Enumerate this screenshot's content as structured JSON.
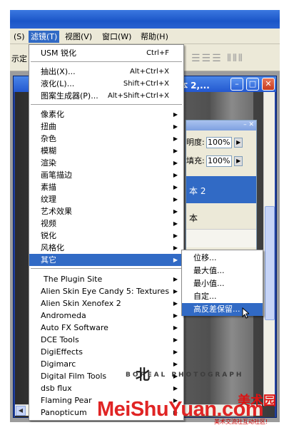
{
  "menubar": {
    "items": [
      "(S)",
      "滤镜(T)",
      "视图(V)",
      "窗口(W)",
      "帮助(H)"
    ]
  },
  "optbar": {
    "label": "示定",
    "align_icons": "☰☰☰ ⫴⫴⫴"
  },
  "document": {
    "title": "本 2,..."
  },
  "layers": {
    "opacity_label": "明度:",
    "opacity_value": "100%",
    "fill_label": "填充:",
    "fill_value": "100%",
    "selected_layer": "本 2",
    "other_layer": "本"
  },
  "filter_menu": {
    "top": [
      {
        "label": "USM 锐化",
        "shortcut": "Ctrl+F"
      }
    ],
    "group2": [
      {
        "label": "抽出(X)...",
        "shortcut": "Alt+Ctrl+X"
      },
      {
        "label": "液化(L)...",
        "shortcut": "Shift+Ctrl+X"
      },
      {
        "label": "图案生成器(P)...",
        "shortcut": "Alt+Shift+Ctrl+X"
      }
    ],
    "submenus": [
      "像素化",
      "扭曲",
      "杂色",
      "模糊",
      "渲染",
      "画笔描边",
      "素描",
      "纹理",
      "艺术效果",
      "视频",
      "锐化",
      "风格化",
      "其它"
    ],
    "plugins": [
      "The Plugin Site",
      "Alien Skin Eye Candy 5: Textures",
      "Alien Skin Xenofex 2",
      "Andromeda",
      "Auto FX Software",
      "DCE Tools",
      "DigiEffects",
      "Digimarc",
      "Digital Film Tools",
      "dsb flux",
      "Flaming Pear",
      "Panopticum"
    ]
  },
  "other_submenu": [
    "位移...",
    "最大值...",
    "最小值...",
    "自定...",
    "高反差保留..."
  ],
  "watermarks": {
    "site": "MeiShuYuan.com",
    "site_dot": ".",
    "cn_logo": "美术园",
    "cn_slogan": "美术交流社互动社区!",
    "photo_mark": "北",
    "photo_text": "BOREAL PHOTOGRAPH"
  }
}
